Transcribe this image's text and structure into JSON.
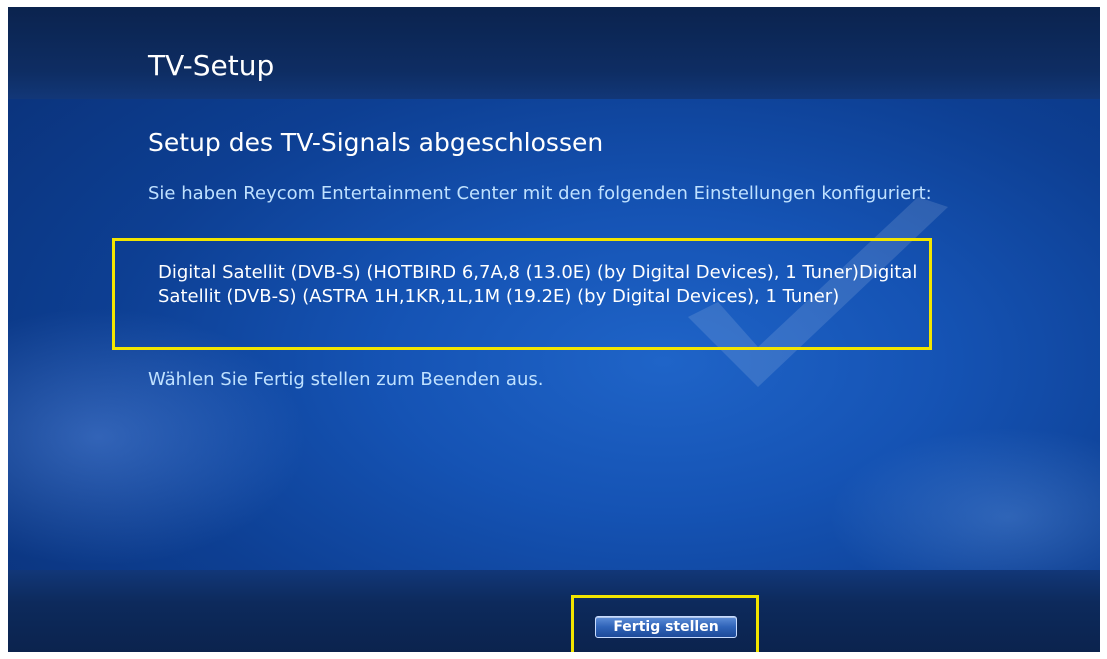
{
  "header": {
    "title": "TV-Setup"
  },
  "main": {
    "heading": "Setup des TV-Signals abgeschlossen",
    "intro": "Sie haben Reycom Entertainment Center mit den folgenden Einstellungen konfiguriert:",
    "settings": "Digital Satellit (DVB-S) (HOTBIRD 6,7A,8 (13.0E) (by Digital Devices), 1 Tuner)Digital Satellit (DVB-S) (ASTRA 1H,1KR,1L,1M (19.2E) (by Digital Devices), 1 Tuner)",
    "instruction": "Wählen Sie Fertig stellen zum Beenden aus."
  },
  "footer": {
    "finish_label": "Fertig stellen"
  },
  "colors": {
    "background": "#1553b4",
    "header_band": "#0e2d63",
    "highlight": "#f2e500",
    "secondary_text": "#bfe1ff"
  },
  "icons": {
    "watermark": "checkmark-icon"
  }
}
